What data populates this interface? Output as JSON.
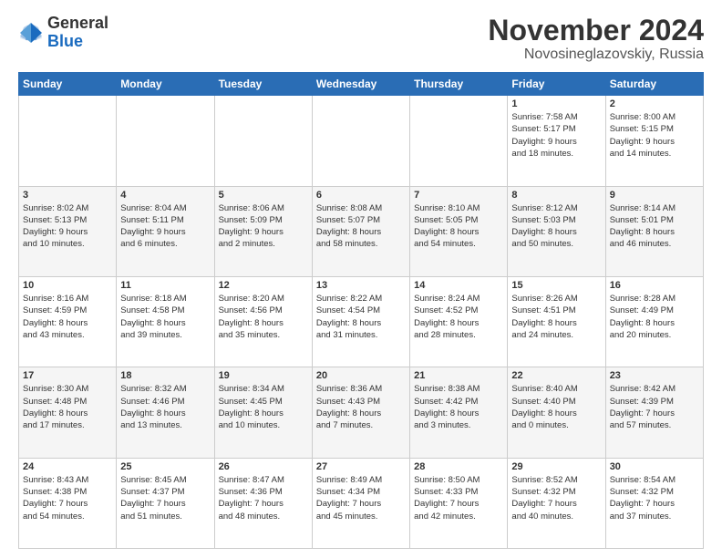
{
  "header": {
    "logo_general": "General",
    "logo_blue": "Blue",
    "month_title": "November 2024",
    "location": "Novosineglazovskiy, Russia"
  },
  "days_of_week": [
    "Sunday",
    "Monday",
    "Tuesday",
    "Wednesday",
    "Thursday",
    "Friday",
    "Saturday"
  ],
  "weeks": [
    [
      {
        "day": "",
        "info": ""
      },
      {
        "day": "",
        "info": ""
      },
      {
        "day": "",
        "info": ""
      },
      {
        "day": "",
        "info": ""
      },
      {
        "day": "",
        "info": ""
      },
      {
        "day": "1",
        "info": "Sunrise: 7:58 AM\nSunset: 5:17 PM\nDaylight: 9 hours\nand 18 minutes."
      },
      {
        "day": "2",
        "info": "Sunrise: 8:00 AM\nSunset: 5:15 PM\nDaylight: 9 hours\nand 14 minutes."
      }
    ],
    [
      {
        "day": "3",
        "info": "Sunrise: 8:02 AM\nSunset: 5:13 PM\nDaylight: 9 hours\nand 10 minutes."
      },
      {
        "day": "4",
        "info": "Sunrise: 8:04 AM\nSunset: 5:11 PM\nDaylight: 9 hours\nand 6 minutes."
      },
      {
        "day": "5",
        "info": "Sunrise: 8:06 AM\nSunset: 5:09 PM\nDaylight: 9 hours\nand 2 minutes."
      },
      {
        "day": "6",
        "info": "Sunrise: 8:08 AM\nSunset: 5:07 PM\nDaylight: 8 hours\nand 58 minutes."
      },
      {
        "day": "7",
        "info": "Sunrise: 8:10 AM\nSunset: 5:05 PM\nDaylight: 8 hours\nand 54 minutes."
      },
      {
        "day": "8",
        "info": "Sunrise: 8:12 AM\nSunset: 5:03 PM\nDaylight: 8 hours\nand 50 minutes."
      },
      {
        "day": "9",
        "info": "Sunrise: 8:14 AM\nSunset: 5:01 PM\nDaylight: 8 hours\nand 46 minutes."
      }
    ],
    [
      {
        "day": "10",
        "info": "Sunrise: 8:16 AM\nSunset: 4:59 PM\nDaylight: 8 hours\nand 43 minutes."
      },
      {
        "day": "11",
        "info": "Sunrise: 8:18 AM\nSunset: 4:58 PM\nDaylight: 8 hours\nand 39 minutes."
      },
      {
        "day": "12",
        "info": "Sunrise: 8:20 AM\nSunset: 4:56 PM\nDaylight: 8 hours\nand 35 minutes."
      },
      {
        "day": "13",
        "info": "Sunrise: 8:22 AM\nSunset: 4:54 PM\nDaylight: 8 hours\nand 31 minutes."
      },
      {
        "day": "14",
        "info": "Sunrise: 8:24 AM\nSunset: 4:52 PM\nDaylight: 8 hours\nand 28 minutes."
      },
      {
        "day": "15",
        "info": "Sunrise: 8:26 AM\nSunset: 4:51 PM\nDaylight: 8 hours\nand 24 minutes."
      },
      {
        "day": "16",
        "info": "Sunrise: 8:28 AM\nSunset: 4:49 PM\nDaylight: 8 hours\nand 20 minutes."
      }
    ],
    [
      {
        "day": "17",
        "info": "Sunrise: 8:30 AM\nSunset: 4:48 PM\nDaylight: 8 hours\nand 17 minutes."
      },
      {
        "day": "18",
        "info": "Sunrise: 8:32 AM\nSunset: 4:46 PM\nDaylight: 8 hours\nand 13 minutes."
      },
      {
        "day": "19",
        "info": "Sunrise: 8:34 AM\nSunset: 4:45 PM\nDaylight: 8 hours\nand 10 minutes."
      },
      {
        "day": "20",
        "info": "Sunrise: 8:36 AM\nSunset: 4:43 PM\nDaylight: 8 hours\nand 7 minutes."
      },
      {
        "day": "21",
        "info": "Sunrise: 8:38 AM\nSunset: 4:42 PM\nDaylight: 8 hours\nand 3 minutes."
      },
      {
        "day": "22",
        "info": "Sunrise: 8:40 AM\nSunset: 4:40 PM\nDaylight: 8 hours\nand 0 minutes."
      },
      {
        "day": "23",
        "info": "Sunrise: 8:42 AM\nSunset: 4:39 PM\nDaylight: 7 hours\nand 57 minutes."
      }
    ],
    [
      {
        "day": "24",
        "info": "Sunrise: 8:43 AM\nSunset: 4:38 PM\nDaylight: 7 hours\nand 54 minutes."
      },
      {
        "day": "25",
        "info": "Sunrise: 8:45 AM\nSunset: 4:37 PM\nDaylight: 7 hours\nand 51 minutes."
      },
      {
        "day": "26",
        "info": "Sunrise: 8:47 AM\nSunset: 4:36 PM\nDaylight: 7 hours\nand 48 minutes."
      },
      {
        "day": "27",
        "info": "Sunrise: 8:49 AM\nSunset: 4:34 PM\nDaylight: 7 hours\nand 45 minutes."
      },
      {
        "day": "28",
        "info": "Sunrise: 8:50 AM\nSunset: 4:33 PM\nDaylight: 7 hours\nand 42 minutes."
      },
      {
        "day": "29",
        "info": "Sunrise: 8:52 AM\nSunset: 4:32 PM\nDaylight: 7 hours\nand 40 minutes."
      },
      {
        "day": "30",
        "info": "Sunrise: 8:54 AM\nSunset: 4:32 PM\nDaylight: 7 hours\nand 37 minutes."
      }
    ]
  ]
}
